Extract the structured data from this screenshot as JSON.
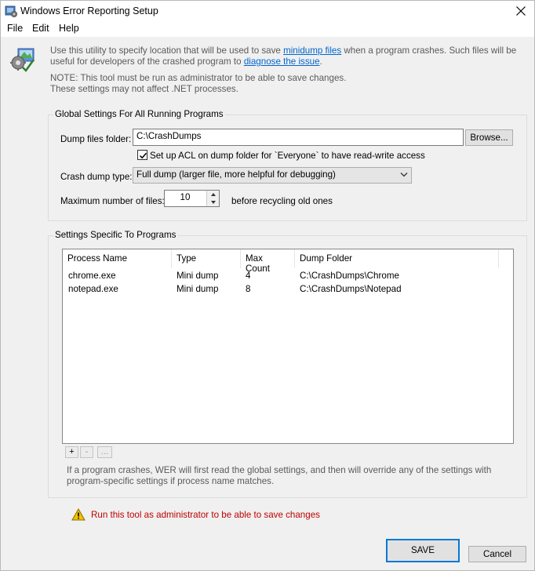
{
  "window": {
    "title": "Windows Error Reporting Setup"
  },
  "menu": {
    "file": "File",
    "edit": "Edit",
    "help": "Help"
  },
  "info": {
    "part1": "Use this utility to specify location that will be used to save ",
    "link1": "minidump files",
    "part2": " when a program crashes. Such files will be useful for developers of the crashed program to ",
    "link2": "diagnose the issue",
    "part3": ".",
    "note_line1": "NOTE: This tool must be run as administrator to be able to save changes.",
    "note_line2": "These settings may not affect .NET processes."
  },
  "global": {
    "legend": "Global Settings For All Running Programs",
    "dump_folder_label": "Dump files folder:",
    "dump_folder_value": "C:\\CrashDumps",
    "browse_label": "Browse...",
    "acl_checked": true,
    "acl_label": "Set up ACL on dump folder for `Everyone` to have read-write access",
    "crash_type_label": "Crash dump type:",
    "crash_type_value": "Full dump (larger file, more helpful for debugging)",
    "max_files_label": "Maximum number of files:",
    "max_files_value": "10",
    "max_files_suffix": "before recycling old ones"
  },
  "specific": {
    "legend": "Settings Specific To Programs",
    "columns": [
      "Process Name",
      "Type",
      "Max Count",
      "Dump Folder"
    ],
    "rows": [
      {
        "process": "chrome.exe",
        "type": "Mini dump",
        "max": "4",
        "folder": "C:\\CrashDumps\\Chrome"
      },
      {
        "process": "notepad.exe",
        "type": "Mini dump",
        "max": "8",
        "folder": "C:\\CrashDumps\\Notepad"
      }
    ],
    "add_label": "+",
    "remove_label": "-",
    "edit_label": "...",
    "hint": "If a program crashes, WER will first read the global settings, and then will override any of the settings with program-specific settings if process name matches."
  },
  "warning": {
    "text": "Run this tool as administrator to be able to save changes"
  },
  "buttons": {
    "save": "SAVE",
    "cancel": "Cancel"
  },
  "colors": {
    "accent": "#0078d7",
    "link": "#0066cc",
    "warning_text": "#c00000",
    "warning_icon": "#f2c200"
  }
}
